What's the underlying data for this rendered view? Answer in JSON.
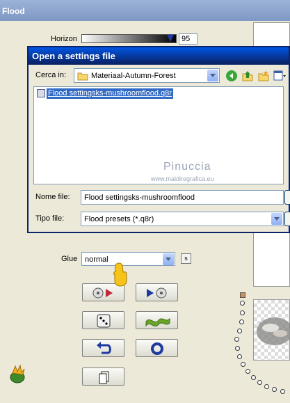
{
  "flood": {
    "title": "Flood",
    "horizon_label": "Horizon",
    "horizon_value": "95",
    "glue_label": "Glue",
    "glue_value": "normal",
    "s_label": "s"
  },
  "dialog": {
    "title": "Open a settings file",
    "look_in_label": "Cerca in:",
    "look_in_value": "Materiaal-Autumn-Forest",
    "files": [
      "Flood settingsks-mushroomflood.q8r"
    ],
    "filename_label": "Nome file:",
    "filename_value": "Flood settingsks-mushroomflood",
    "filetype_label": "Tipo file:",
    "filetype_value": "Flood presets (*.q8r)"
  },
  "watermark": {
    "name": "Pinuccia",
    "url": "www.maidiregrafica.eu"
  },
  "colors": {
    "dialog_title": "#0a246a",
    "selection": "#316ac5",
    "flood_title": "#7f98c4"
  }
}
